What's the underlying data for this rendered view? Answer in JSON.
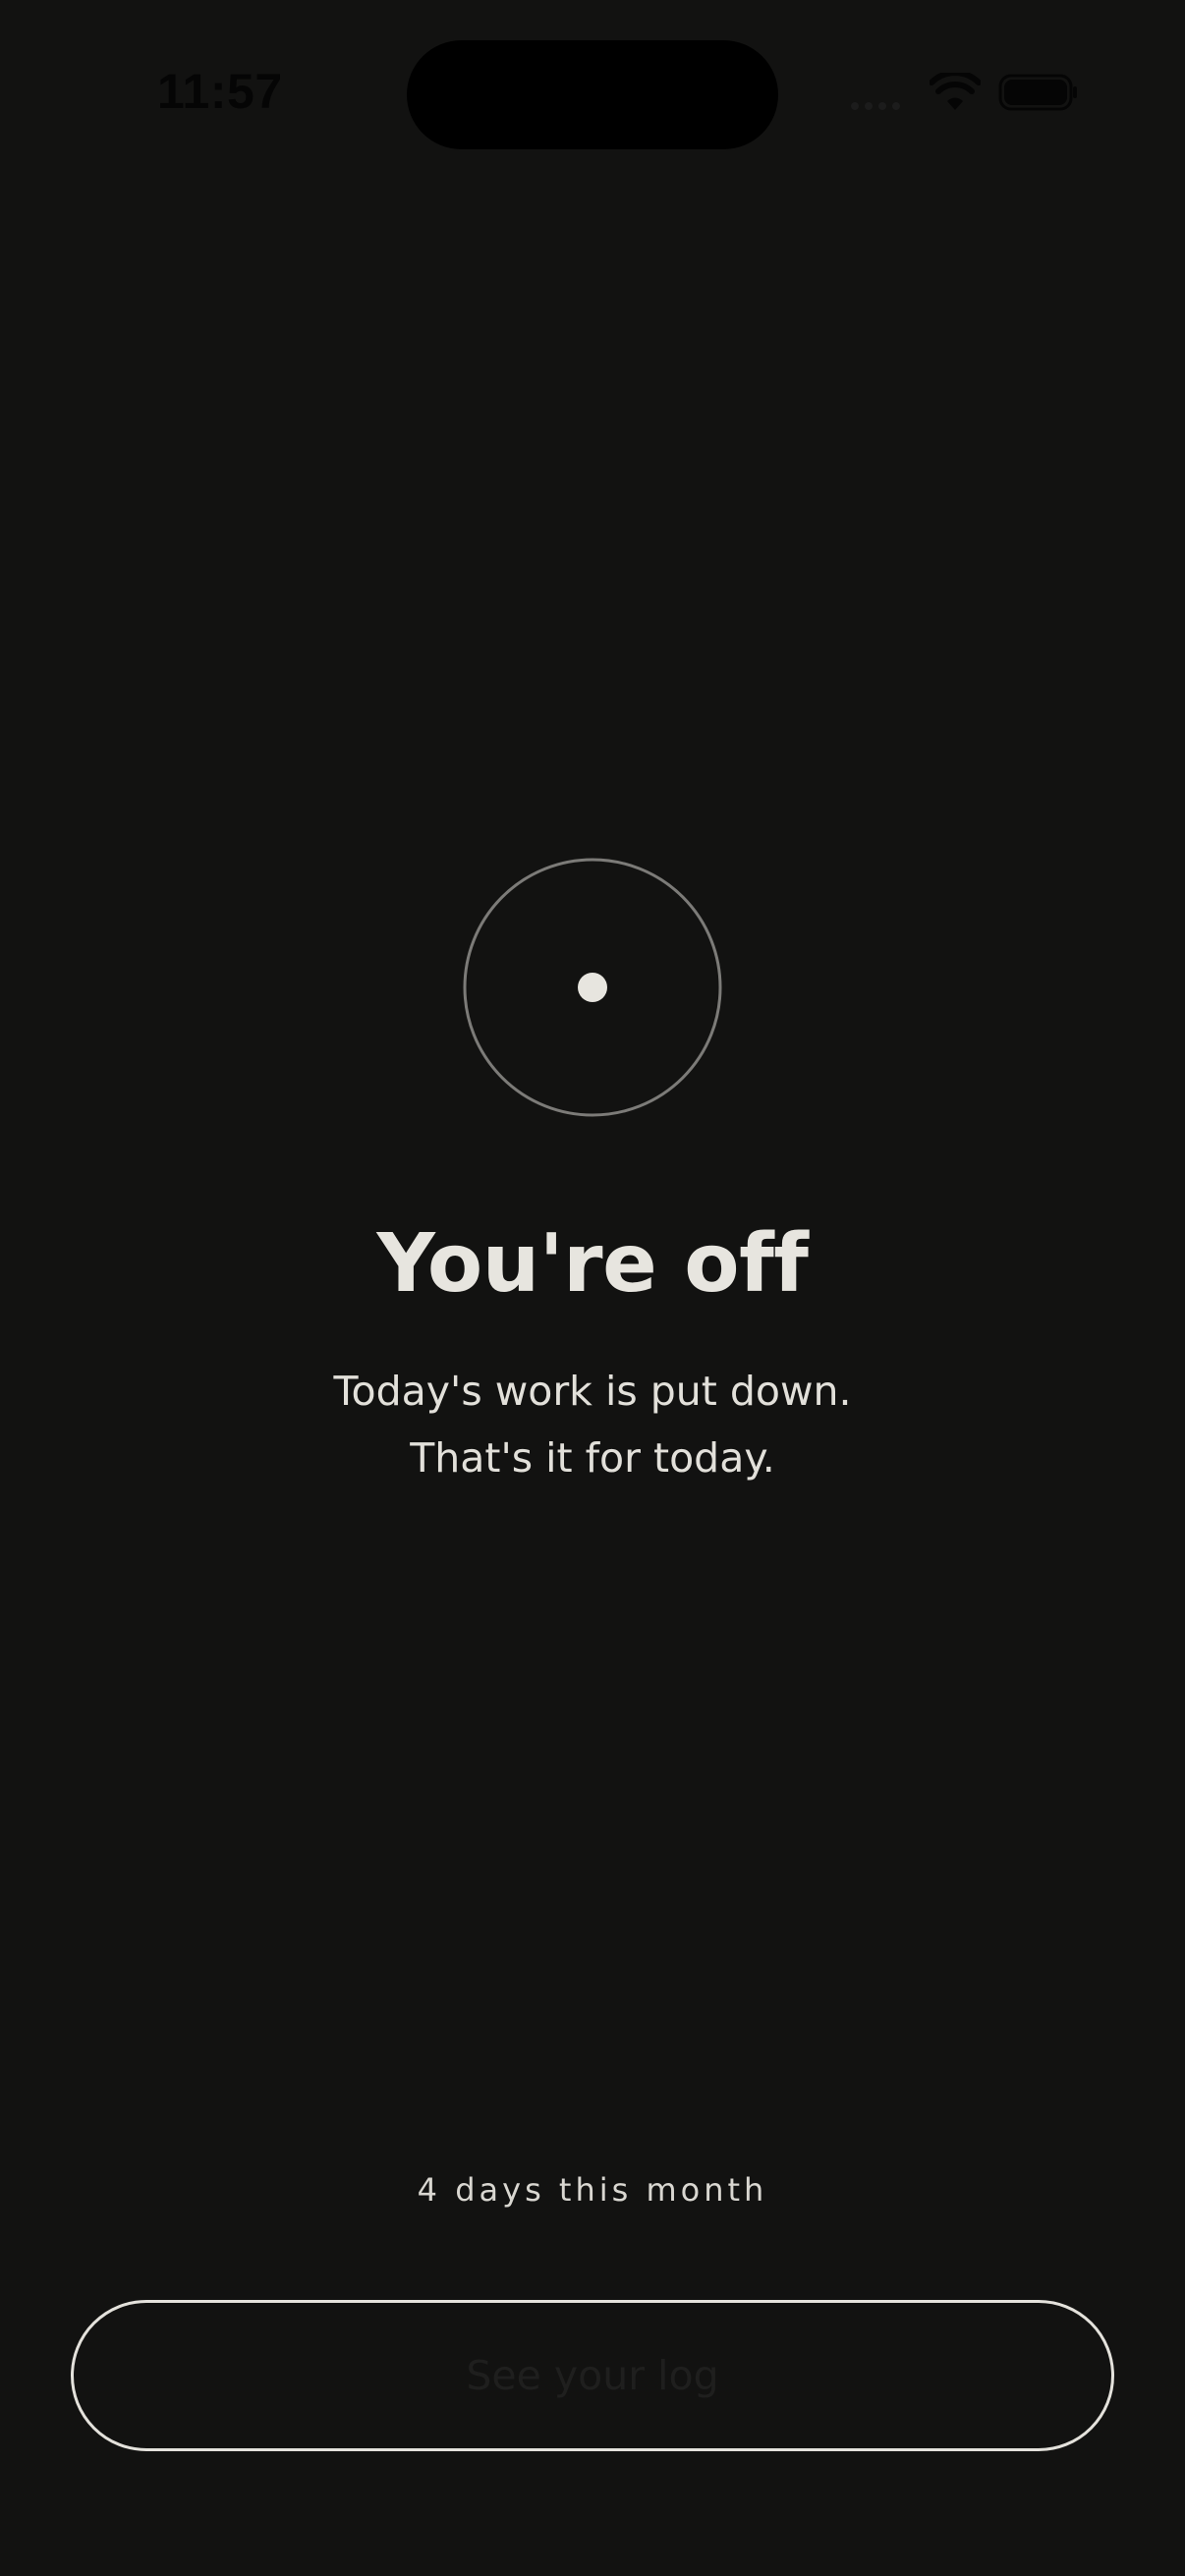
{
  "status_bar": {
    "time": "11:57",
    "icons": [
      "cellular-signal-icon",
      "wifi-icon",
      "battery-icon"
    ]
  },
  "off_screen": {
    "icon": "ring-dot-icon",
    "title": "You're off",
    "subtitle_lines": [
      "Today's work is put down.",
      "That's it for today."
    ],
    "month_count": "4 days this month",
    "log_button_label": "See your log"
  },
  "colors": {
    "background": "#121211",
    "text_primary": "#e7e5df",
    "ring_stroke": "#7c7b78",
    "button_border": "#e4e2dc"
  }
}
